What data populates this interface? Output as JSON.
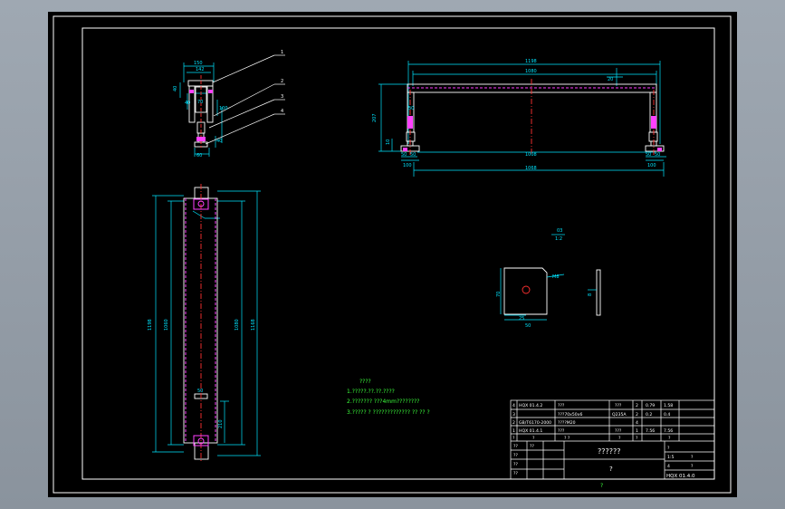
{
  "colors": {
    "frame": "#ffffff",
    "dim": "#00e5ff",
    "part": "#ffffff",
    "center": "#ff3030",
    "hidden": "#ff40ff",
    "note": "#3cff3c",
    "table": "#ffffff"
  },
  "side_view": {
    "dims": [
      "150",
      "142",
      "40",
      "40",
      "70",
      "100",
      "40",
      "60"
    ],
    "balloons": [
      "1",
      "2",
      "3",
      "4"
    ]
  },
  "front_view": {
    "dims": [
      "1198",
      "1080",
      "20",
      "207",
      "50",
      "10",
      "50",
      "50",
      "100",
      "1008",
      "1068",
      "100",
      "50",
      "50"
    ]
  },
  "plan_view": {
    "dims": [
      "1198",
      "1060",
      "1080",
      "1168",
      "50",
      "210"
    ]
  },
  "detail": {
    "label_top": "03",
    "label_bottom": "1:2",
    "dims": [
      "70",
      "25",
      "50",
      "M8",
      "8"
    ]
  },
  "notes": {
    "title": "????",
    "line1": "1.?????.??.??.????",
    "line2": "2.??????? ???4mm????????",
    "line3": "3.?????  ?  ?????????????  ?? ??  ?"
  },
  "title_block": {
    "rows": [
      {
        "no": "4",
        "code": "HQX 01.4.2",
        "name": "???",
        "qty": "2",
        "mat": "???",
        "w1": "0.79",
        "w2": "1.58"
      },
      {
        "no": "3",
        "code": "",
        "name": "???70x50x6",
        "qty": "2",
        "mat": "Q235A",
        "w1": "0.2",
        "w2": "0.4"
      },
      {
        "no": "2",
        "code": "GB/T6170-2000",
        "name": "????M20",
        "qty": "4",
        "mat": "",
        "w1": "",
        "w2": ""
      },
      {
        "no": "1",
        "code": "HQX 01.4.1",
        "name": "???",
        "qty": "1",
        "mat": "???",
        "w1": "7.56",
        "w2": "7.56"
      }
    ],
    "header": [
      "?",
      "?",
      "? ?",
      "?",
      "?",
      "?"
    ],
    "drawing_title": "??????",
    "subtitle": "?",
    "drawing_number": "HQX 01.4.0",
    "side_labels": [
      "?",
      "1:5",
      "4",
      "?",
      "?"
    ],
    "sign_labels": [
      "??",
      "??",
      "??",
      "??",
      "??"
    ],
    "footer": "?"
  }
}
